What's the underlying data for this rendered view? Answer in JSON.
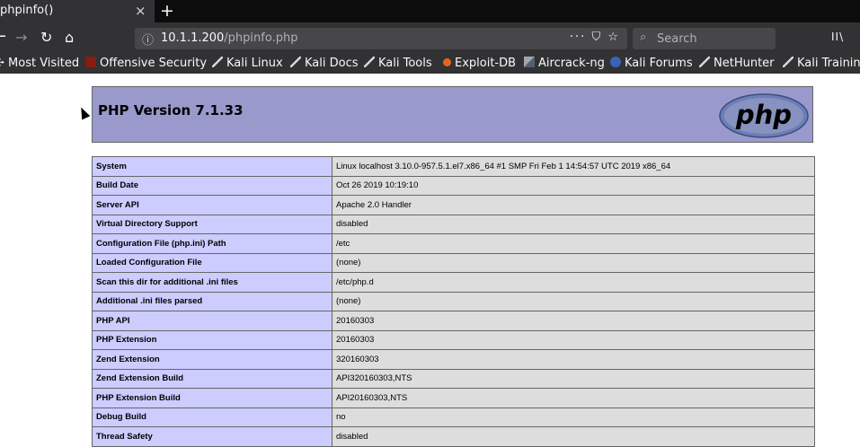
{
  "browser": {
    "tab": {
      "title": "phpinfo()",
      "close": "×",
      "new_tab": "+"
    },
    "nav": {
      "back": "←",
      "forward": "→",
      "reload": "↻",
      "home": "⌂",
      "url_host": "10.1.1.200",
      "url_path": "/phpinfo.php",
      "url_actions": "··· ⛉ ☆",
      "search_placeholder": "Search",
      "search_icon": "⌕",
      "library": "II\\"
    },
    "bookmarks": [
      {
        "label": "✢ Most Visited",
        "icon": "star-icon"
      },
      {
        "label": "Offensive Security",
        "icon": "offsec-icon"
      },
      {
        "label": "Kali Linux",
        "icon": "kali-dragon-icon"
      },
      {
        "label": "Kali Docs",
        "icon": "kali-dragon-icon"
      },
      {
        "label": "Kali Tools",
        "icon": "kali-dragon-icon"
      },
      {
        "label": "Exploit-DB",
        "icon": "exploit-db-icon"
      },
      {
        "label": "Aircrack-ng",
        "icon": "aircrack-icon"
      },
      {
        "label": "Kali Forums",
        "icon": "kali-forums-icon"
      },
      {
        "label": "NetHunter",
        "icon": "kali-dragon-icon"
      },
      {
        "label": "Kali Training",
        "icon": "kali-dragon-icon"
      }
    ]
  },
  "php": {
    "title": "PHP Version 7.1.33",
    "logo_text": "php",
    "colors": {
      "header_bg": "#9999cc",
      "key_bg": "#ccccff",
      "value_bg": "#dddddd"
    },
    "rows": [
      {
        "key": "System",
        "value": "Linux localhost 3.10.0-957.5.1.el7.x86_64 #1 SMP Fri Feb 1 14:54:57 UTC 2019 x86_64"
      },
      {
        "key": "Build Date",
        "value": "Oct 26 2019 10:19:10"
      },
      {
        "key": "Server API",
        "value": "Apache 2.0 Handler"
      },
      {
        "key": "Virtual Directory Support",
        "value": "disabled"
      },
      {
        "key": "Configuration File (php.ini) Path",
        "value": "/etc"
      },
      {
        "key": "Loaded Configuration File",
        "value": "(none)"
      },
      {
        "key": "Scan this dir for additional .ini files",
        "value": "/etc/php.d"
      },
      {
        "key": "Additional .ini files parsed",
        "value": "(none)"
      },
      {
        "key": "PHP API",
        "value": "20160303"
      },
      {
        "key": "PHP Extension",
        "value": "20160303"
      },
      {
        "key": "Zend Extension",
        "value": "320160303"
      },
      {
        "key": "Zend Extension Build",
        "value": "API320160303,NTS"
      },
      {
        "key": "PHP Extension Build",
        "value": "API20160303,NTS"
      },
      {
        "key": "Debug Build",
        "value": "no"
      },
      {
        "key": "Thread Safety",
        "value": "disabled"
      }
    ]
  }
}
